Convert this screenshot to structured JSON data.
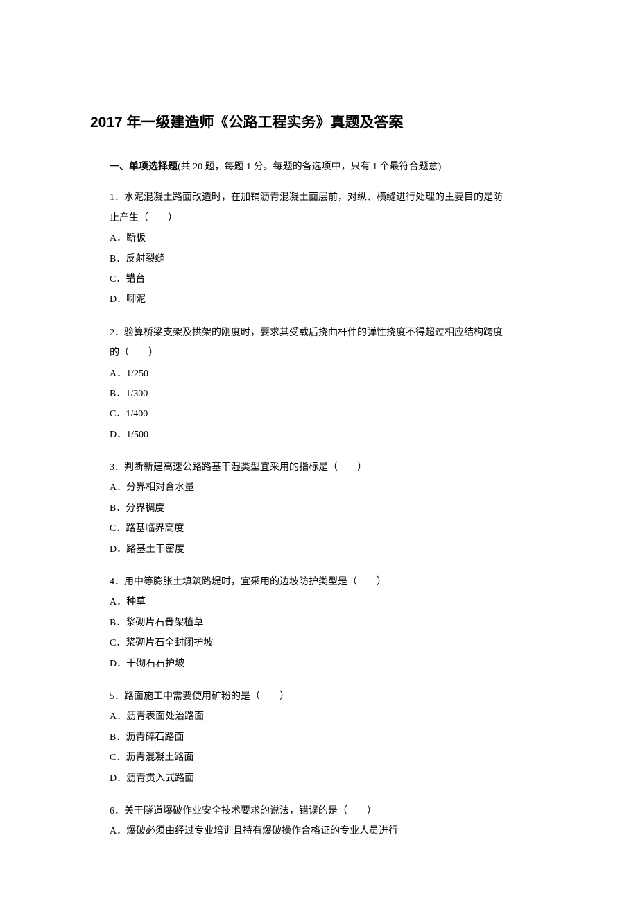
{
  "title": "2017 年一级建造师《公路工程实务》真题及答案",
  "section": {
    "label_bold": "一、单项选择题",
    "label_rest": "(共 20 题，每题 1 分。每题的备选项中，只有 1 个最符合题意)"
  },
  "questions": [
    {
      "text_lines": [
        "1．水泥混凝土路面改造时，在加铺沥青混凝土面层前，对纵、横缝进行处理的主要目的是防",
        "止产生（　　）"
      ],
      "options": [
        "A．断板",
        "B．反射裂缝",
        "C．错台",
        "D．唧泥"
      ]
    },
    {
      "text_lines": [
        "2．验算桥梁支架及拱架的刚度时，要求其受载后挠曲杆件的弹性挠度不得超过相应结构跨度",
        "的（　　）"
      ],
      "options": [
        "A．1/250",
        "B．1/300",
        "C．1/400",
        "D．1/500"
      ]
    },
    {
      "text_lines": [
        "3．判断新建高速公路路基干湿类型宜采用的指标是（　　）"
      ],
      "options": [
        "A．分界相对含水量",
        "B．分界稠度",
        "C．路基临界高度",
        "D．路基土干密度"
      ]
    },
    {
      "text_lines": [
        "4．用中等膨胀土填筑路堤时，宜采用的边坡防护类型是（　　）"
      ],
      "options": [
        "A．种草",
        "B．浆砌片石骨架植草",
        "C．浆砌片石全封闭护坡",
        "D．干砌石石护坡"
      ]
    },
    {
      "text_lines": [
        "5．路面施工中需要使用矿粉的是（　　）"
      ],
      "options": [
        "A．沥青表面处治路面",
        "B．沥青碎石路面",
        "C．沥青混凝土路面",
        "D．沥青贯入式路面"
      ]
    },
    {
      "text_lines": [
        "6．关于隧道爆破作业安全技术要求的说法，错误的是（　　）"
      ],
      "options": [
        "A．爆破必须由经过专业培训且持有爆破操作合格证的专业人员进行"
      ]
    }
  ]
}
